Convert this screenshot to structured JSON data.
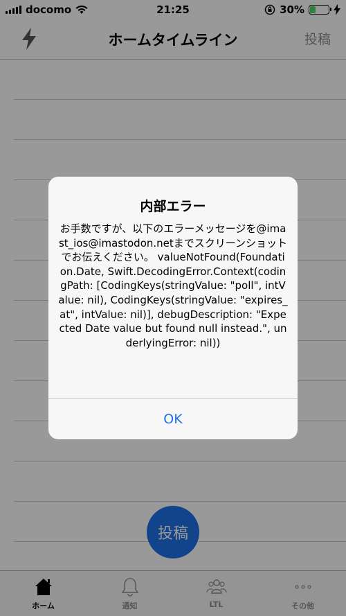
{
  "status_bar": {
    "carrier": "docomo",
    "time": "21:25",
    "battery_percent": "30%"
  },
  "nav": {
    "title": "ホームタイムライン",
    "right_button": "投稿",
    "left_icon": "bolt-icon"
  },
  "fab": {
    "label": "投稿"
  },
  "tabs": [
    {
      "label": "ホーム",
      "icon": "home-icon",
      "active": true
    },
    {
      "label": "通知",
      "icon": "bell-icon",
      "active": false
    },
    {
      "label": "LTL",
      "icon": "people-icon",
      "active": false
    },
    {
      "label": "その他",
      "icon": "more-icon",
      "active": false
    }
  ],
  "alert": {
    "title": "内部エラー",
    "message": "お手数ですが、以下のエラーメッセージを@imast_ios@imastodon.netまでスクリーンショットでお伝えください。\nvalueNotFound(Foundation.Date, Swift.DecodingError.Context(codingPath: [CodingKeys(stringValue: \"poll\", intValue: nil), CodingKeys(stringValue: \"expires_at\", intValue: nil)], debugDescription: \"Expected Date value but found null instead.\", underlyingError: nil))",
    "button": "OK"
  },
  "colors": {
    "accent": "#1e72e8",
    "battery": "#4cd964"
  }
}
